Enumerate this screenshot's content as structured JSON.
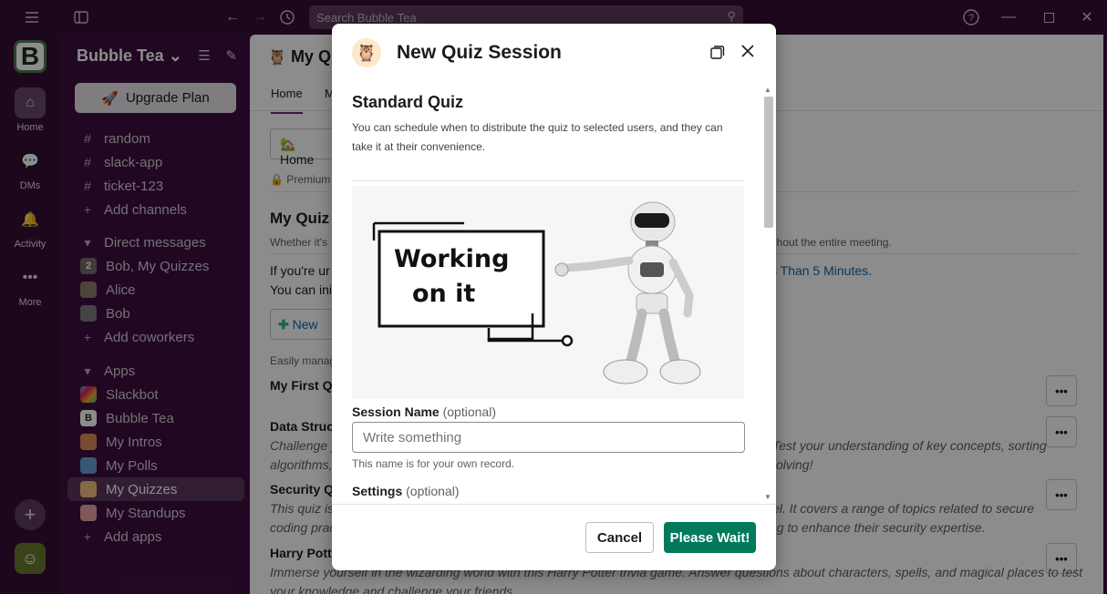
{
  "topbar": {
    "search_placeholder": "Search Bubble Tea"
  },
  "rail": {
    "workspace_initial": "B",
    "items": [
      {
        "label": "Home"
      },
      {
        "label": "DMs"
      },
      {
        "label": "Activity"
      },
      {
        "label": "More"
      }
    ]
  },
  "sidebar": {
    "workspace_name": "Bubble Tea",
    "upgrade_label": "Upgrade Plan",
    "channels": [
      "random",
      "slack-app",
      "ticket-123"
    ],
    "add_channels": "Add channels",
    "dm_header": "Direct messages",
    "dms": [
      {
        "name": "Bob, My Quizzes",
        "badge": "2"
      },
      {
        "name": "Alice"
      },
      {
        "name": "Bob"
      }
    ],
    "add_coworkers": "Add coworkers",
    "apps_header": "Apps",
    "apps": [
      "Slackbot",
      "Bubble Tea",
      "My Intros",
      "My Polls",
      "My Quizzes",
      "My Standups"
    ],
    "add_apps": "Add apps"
  },
  "main": {
    "title": "My Q",
    "tabs": [
      "Home",
      "M"
    ],
    "home_button": "Home",
    "premium": "Premium",
    "heading": "My Quiz",
    "sub_left": "Whether it's",
    "sub_right": "ghout the entire meeting.",
    "line1_left": "If you're ur",
    "line1_link": "s Than 5 Minutes.",
    "line2_left": "You can ini",
    "new_button": "New",
    "easily": "Easily manag",
    "quiz1": "My First Q",
    "quiz2": "Data Struc",
    "quiz2_d1l": "Challenge y",
    "quiz2_d1r": "Test your understanding of key concepts, sorting",
    "quiz2_d2l": "algorithms,",
    "quiz2_d2r": "olving!",
    "quiz3": "Security Q",
    "quiz3_d1l": "This quiz is",
    "quiz3_d1r": "vel. It covers a range of topics related to secure",
    "quiz3_d2l": "coding prac",
    "quiz3_d2r": "ng to enhance their security expertise.",
    "quiz4": "Harry Pott",
    "quiz4_d1": "Immerse yourself in the wizarding world with this Harry Potter trivia game. Answer questions about characters, spells, and magical places to test",
    "quiz4_d2": "your knowledge and challenge your friends."
  },
  "modal": {
    "title": "New Quiz Session",
    "section_title": "Standard Quiz",
    "section_desc": "You can schedule when to distribute the quiz to selected users, and they can take it at their convenience.",
    "illustration_text_1": "Working",
    "illustration_text_2": "on it",
    "session_label": "Session Name",
    "optional": "(optional)",
    "session_placeholder": "Write something",
    "session_hint": "This name is for your own record.",
    "settings_label": "Settings",
    "settings_optional": "(optional)",
    "cancel": "Cancel",
    "submit": "Please Wait!"
  },
  "colors": {
    "aubergine": "#3f0e40",
    "primary": "#007a5a"
  }
}
